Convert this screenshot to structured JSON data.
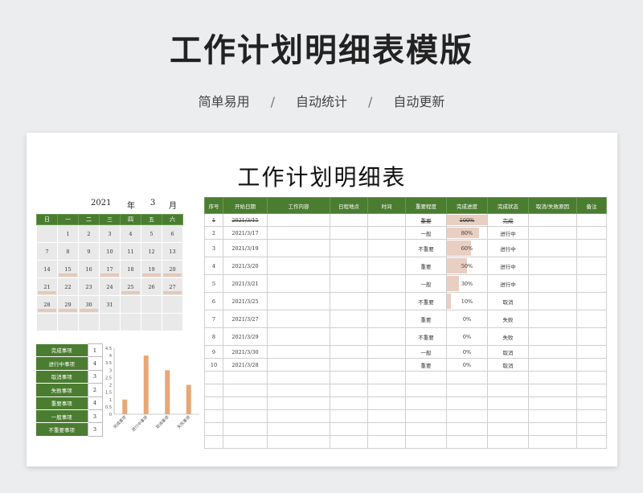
{
  "header": {
    "title": "工作计划明细表模版",
    "subtitle_items": [
      "简单易用",
      "自动统计",
      "自动更新"
    ],
    "separator": "/"
  },
  "sheet": {
    "title": "工作计划明细表"
  },
  "calendar": {
    "year": "2021",
    "year_label": "年",
    "month": "3",
    "month_label": "月",
    "weekdays": [
      "日",
      "一",
      "二",
      "三",
      "四",
      "五",
      "六"
    ],
    "weeks": [
      [
        {
          "d": ""
        },
        {
          "d": "1"
        },
        {
          "d": "2"
        },
        {
          "d": "3"
        },
        {
          "d": "4"
        },
        {
          "d": "5"
        },
        {
          "d": "6"
        }
      ],
      [
        {
          "d": "7"
        },
        {
          "d": "8"
        },
        {
          "d": "9"
        },
        {
          "d": "10"
        },
        {
          "d": "11"
        },
        {
          "d": "12"
        },
        {
          "d": "13"
        }
      ],
      [
        {
          "d": "14"
        },
        {
          "d": "15",
          "mark": true
        },
        {
          "d": "16"
        },
        {
          "d": "17",
          "mark": true
        },
        {
          "d": "18"
        },
        {
          "d": "19",
          "mark": true
        },
        {
          "d": "20",
          "mark": true
        }
      ],
      [
        {
          "d": "21",
          "mark": true
        },
        {
          "d": "22"
        },
        {
          "d": "23"
        },
        {
          "d": "24"
        },
        {
          "d": "25",
          "mark": true
        },
        {
          "d": "26"
        },
        {
          "d": "27",
          "mark": true
        }
      ],
      [
        {
          "d": "28",
          "mark": true
        },
        {
          "d": "29",
          "mark": true
        },
        {
          "d": "30",
          "mark": true
        },
        {
          "d": "31"
        },
        {
          "d": ""
        },
        {
          "d": ""
        },
        {
          "d": ""
        }
      ],
      [
        {
          "d": ""
        },
        {
          "d": ""
        },
        {
          "d": ""
        },
        {
          "d": ""
        },
        {
          "d": ""
        },
        {
          "d": ""
        },
        {
          "d": ""
        }
      ]
    ],
    "colors": {
      "header": "#4b7d31",
      "cell": "#e9e9e9",
      "marker": "#e6c9b9"
    }
  },
  "stats": [
    {
      "label": "完成事项",
      "value": "1"
    },
    {
      "label": "进行中事项",
      "value": "4"
    },
    {
      "label": "取消事项",
      "value": "3"
    },
    {
      "label": "失败事项",
      "value": "2"
    },
    {
      "label": "重要事项",
      "value": "4"
    },
    {
      "label": "一般事项",
      "value": "3"
    },
    {
      "label": "不重要事项",
      "value": "3"
    }
  ],
  "chart_data": {
    "type": "bar",
    "categories": [
      "完成事项",
      "进行中事项",
      "取消事项",
      "失败事项"
    ],
    "values": [
      1,
      4,
      3,
      2
    ],
    "ylim": [
      0,
      4.5
    ],
    "yticks": [
      "0",
      "0.5",
      "1",
      "1.5",
      "2",
      "2.5",
      "3",
      "3.5",
      "4",
      "4.5"
    ],
    "bar_color": "#e8a775",
    "grid": false
  },
  "table": {
    "columns": [
      "序号",
      "开始日期",
      "工作内容",
      "日程地点",
      "时间",
      "重要程度",
      "完成进度",
      "完成状态",
      "取消/失败原因",
      "备注"
    ],
    "rows": [
      {
        "no": "1",
        "date": "2021/3/15",
        "importance": "重要",
        "imp_color": "red",
        "progress": "100%",
        "pct": 1.0,
        "status": "完成",
        "done": true
      },
      {
        "no": "2",
        "date": "2021/3/17",
        "importance": "一般",
        "imp_color": "green",
        "progress": "80%",
        "pct": 0.8,
        "status": "进行中"
      },
      {
        "no": "3",
        "date": "2021/3/19",
        "importance": "不重要",
        "imp_color": "dark",
        "progress": "60%",
        "pct": 0.6,
        "status": "进行中"
      },
      {
        "no": "4",
        "date": "2021/3/20",
        "importance": "重要",
        "imp_color": "red",
        "progress": "50%",
        "pct": 0.5,
        "status": "进行中"
      },
      {
        "no": "5",
        "date": "2021/3/21",
        "importance": "一般",
        "imp_color": "green",
        "progress": "30%",
        "pct": 0.3,
        "status": "进行中"
      },
      {
        "no": "6",
        "date": "2021/3/25",
        "importance": "不重要",
        "imp_color": "dark",
        "progress": "10%",
        "pct": 0.1,
        "status": "取消"
      },
      {
        "no": "7",
        "date": "2021/3/27",
        "importance": "重要",
        "imp_color": "red",
        "progress": "0%",
        "pct": 0,
        "status": "失败"
      },
      {
        "no": "8",
        "date": "2021/3/29",
        "importance": "不重要",
        "imp_color": "dark",
        "progress": "0%",
        "pct": 0,
        "status": "失败"
      },
      {
        "no": "9",
        "date": "2021/3/30",
        "importance": "一般",
        "imp_color": "green",
        "progress": "0%",
        "pct": 0,
        "status": "取消"
      },
      {
        "no": "10",
        "date": "2021/3/28",
        "importance": "重要",
        "imp_color": "red",
        "progress": "0%",
        "pct": 0,
        "status": "取消"
      }
    ],
    "empty_rows": 6,
    "colors": {
      "header": "#4b7d31",
      "progress_bar": "#e9cfc1",
      "important": "#d9305a",
      "normal": "#4d9a7c"
    }
  }
}
